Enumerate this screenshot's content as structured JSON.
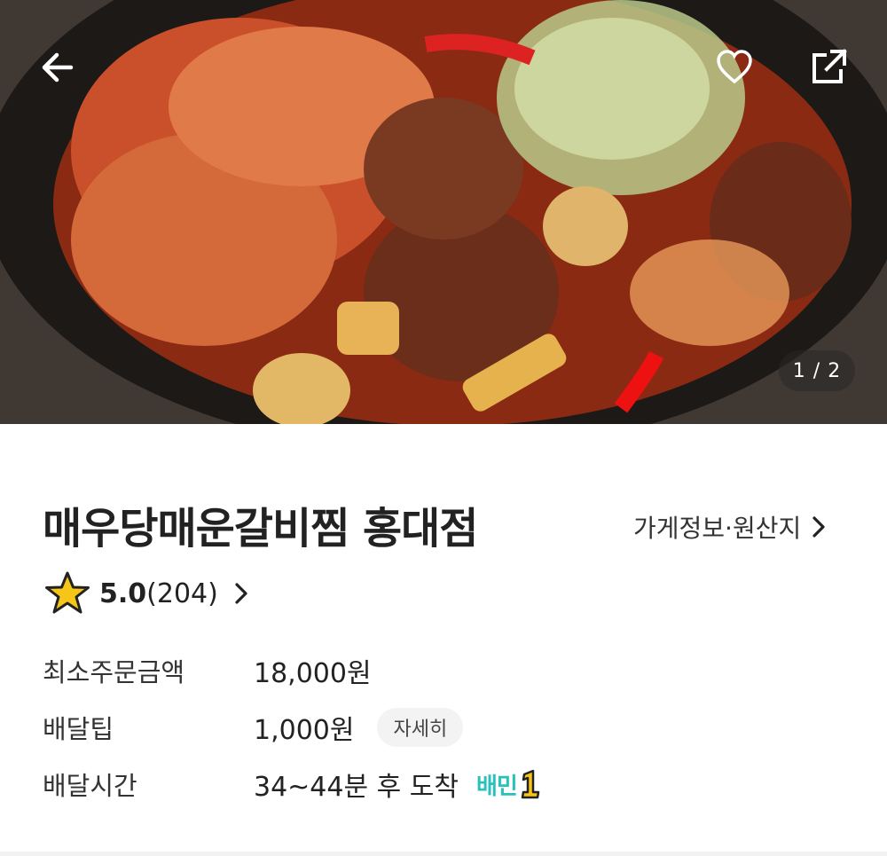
{
  "header": {
    "back_icon": "arrow-left-icon",
    "heart_icon": "heart-outline-icon",
    "share_icon": "share-external-icon",
    "page_indicator": "1 / 2"
  },
  "store": {
    "name": "매우당매운갈비찜 홍대점",
    "info_link_label": "가게정보·원산지",
    "rating": {
      "score": "5.0",
      "count": "(204)"
    },
    "details": [
      {
        "key": "최소주문금액",
        "value": "18,000원"
      },
      {
        "key": "배달팁",
        "value": "1,000원",
        "button": "자세히"
      },
      {
        "key": "배달시간",
        "value": "34~44분 후 도착",
        "badge": "배민"
      }
    ]
  },
  "colors": {
    "accent_mint": "#2ac1bc",
    "star_yellow": "#f5c518"
  }
}
